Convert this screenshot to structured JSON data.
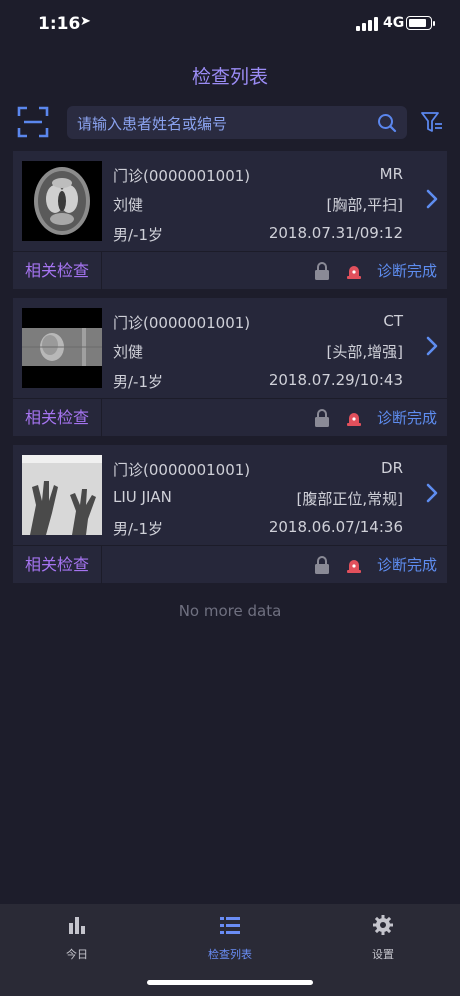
{
  "status": {
    "time": "1:16",
    "network": "4G",
    "battery_level": 0.9
  },
  "title": "检查列表",
  "search": {
    "placeholder": "请输入患者姓名或编号"
  },
  "cards": [
    {
      "visit": "门诊(0000001001)",
      "modality": "MR",
      "name": "刘健",
      "body_part": "[胸部,平扫]",
      "sex_age": "男/-1岁",
      "datetime": "2018.07.31/09:12",
      "related": "相关检查",
      "status": "诊断完成"
    },
    {
      "visit": "门诊(0000001001)",
      "modality": "CT",
      "name": "刘健",
      "body_part": "[头部,增强]",
      "sex_age": "男/-1岁",
      "datetime": "2018.07.29/10:43",
      "related": "相关检查",
      "status": "诊断完成"
    },
    {
      "visit": "门诊(0000001001)",
      "modality": "DR",
      "name": "LIU JIAN",
      "body_part": "[腹部正位,常规]",
      "sex_age": "男/-1岁",
      "datetime": "2018.06.07/14:36",
      "related": "相关检查",
      "status": "诊断完成"
    }
  ],
  "no_more": "No more data",
  "tabs": [
    {
      "label": "今日",
      "icon": "bar-chart-icon"
    },
    {
      "label": "检查列表",
      "icon": "list-icon"
    },
    {
      "label": "设置",
      "icon": "gear-icon"
    }
  ],
  "colors": {
    "accent": "#6a8df5",
    "title": "#9b8cf5",
    "related": "#a574f0",
    "background": "#1d1d2b",
    "card": "#26273a"
  }
}
